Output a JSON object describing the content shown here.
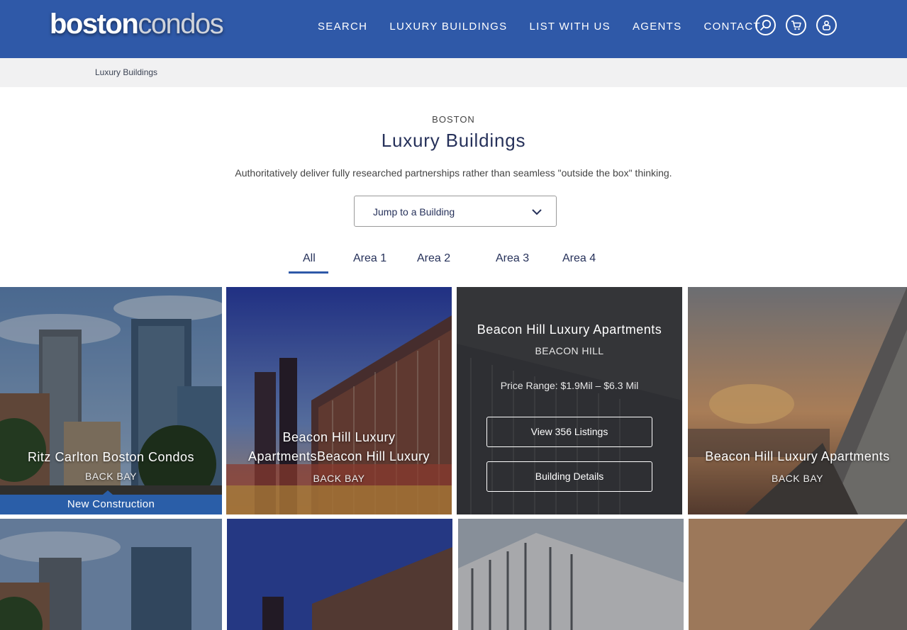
{
  "header": {
    "logo_word1": "boston",
    "logo_word2": "condos",
    "nav": [
      "SEARCH",
      "LUXURY BUILDINGS",
      "LIST WITH US",
      "AGENTS",
      "CONTACT"
    ],
    "icons": [
      "search-icon",
      "cart-icon",
      "user-icon"
    ]
  },
  "breadcrumb": {
    "current": "Luxury Buildings"
  },
  "intro": {
    "eyebrow": "BOSTON",
    "title": "Luxury Buildings",
    "subtitle": "Authoritatively deliver fully researched partnerships rather than seamless \"outside the box\" thinking."
  },
  "jump": {
    "label": "Jump to a Building"
  },
  "tabs": [
    "All",
    "Area 1",
    "Area 2",
    "Area 3",
    "Area 4"
  ],
  "active_tab": "All",
  "cards": [
    {
      "name": "Ritz Carlton Boston Condos",
      "area": "BACK BAY",
      "banner": "New Construction"
    },
    {
      "name_line1": "Beacon Hill Luxury",
      "name_line2": "ApartmentsBeacon Hill Luxury",
      "area": "BACK BAY"
    },
    {
      "name": "Beacon Hill Luxury Apartments",
      "area": "BEACON HILL",
      "price": "Price Range: $1.9Mil – $6.3 Mil",
      "btn_listings": "View 356 Listings",
      "btn_details": "Building Details"
    },
    {
      "name": "Beacon Hill Luxury Apartments",
      "area": "BACK BAY"
    }
  ],
  "colors": {
    "brand": "#2f59a8",
    "banner": "#2a5ea8",
    "heading": "#26315a"
  }
}
